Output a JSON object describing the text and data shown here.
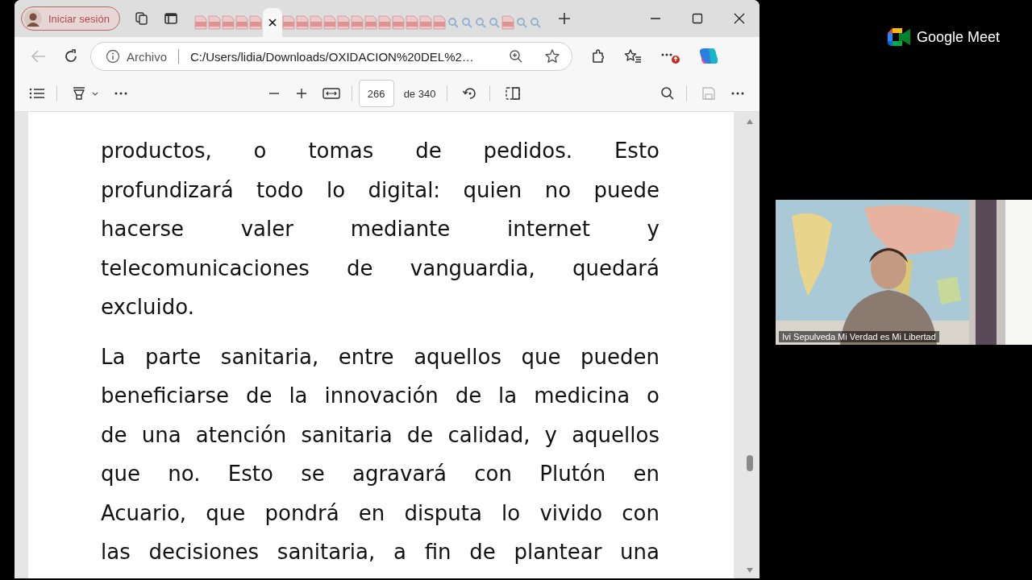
{
  "browser": {
    "profile_button": {
      "label": "Iniciar sesión"
    },
    "tabs": [
      {
        "kind": "pdf",
        "selected": false
      },
      {
        "kind": "pdf",
        "selected": false
      },
      {
        "kind": "pdf",
        "selected": false
      },
      {
        "kind": "pdf",
        "selected": false
      },
      {
        "kind": "pdf",
        "selected": false
      },
      {
        "kind": "pdf",
        "selected": true
      },
      {
        "kind": "pdf",
        "selected": false
      },
      {
        "kind": "pdf",
        "selected": false
      },
      {
        "kind": "pdf",
        "selected": false
      },
      {
        "kind": "pdf",
        "selected": false
      },
      {
        "kind": "pdf",
        "selected": false
      },
      {
        "kind": "pdf",
        "selected": false
      },
      {
        "kind": "pdf",
        "selected": false
      },
      {
        "kind": "pdf",
        "selected": false
      },
      {
        "kind": "pdf",
        "selected": false
      },
      {
        "kind": "pdf",
        "selected": false
      },
      {
        "kind": "pdf",
        "selected": false
      },
      {
        "kind": "pdf",
        "selected": false
      },
      {
        "kind": "search",
        "selected": false
      },
      {
        "kind": "search",
        "selected": false
      },
      {
        "kind": "search",
        "selected": false
      },
      {
        "kind": "search",
        "selected": false
      },
      {
        "kind": "pdf",
        "selected": false
      },
      {
        "kind": "search",
        "selected": false
      },
      {
        "kind": "search",
        "selected": false
      }
    ],
    "address_bar": {
      "security_label": "Archivo",
      "url": "C:/Users/lidia/Downloads/OXIDACION%20DEL%2…"
    },
    "pdf_toolbar": {
      "page": "266",
      "page_count": "de 340"
    },
    "document": {
      "paragraphs": [
        {
          "lines": [
            "productos, o tomas de pedidos. Esto",
            "profundizará todo lo digital: quien no puede",
            "hacerse valer mediante internet y",
            "telecomunicaciones de vanguardia, quedará",
            "excluido."
          ]
        },
        {
          "lines": [
            "La parte sanitaria, entre aquellos que pueden",
            "beneficiarse de la innovación de la medicina o",
            "de una atención sanitaria de calidad, y aquellos",
            "que no. Esto se agravará con Plutón en",
            "Acuario, que pondrá en disputa lo vivido con",
            "las decisiones sanitaria, a fin de plantear una"
          ]
        }
      ]
    }
  },
  "meet": {
    "brand": "Google Meet",
    "participant": {
      "name": "Ivi Sepulveda Mi Verdad es Mi Libertad"
    }
  }
}
